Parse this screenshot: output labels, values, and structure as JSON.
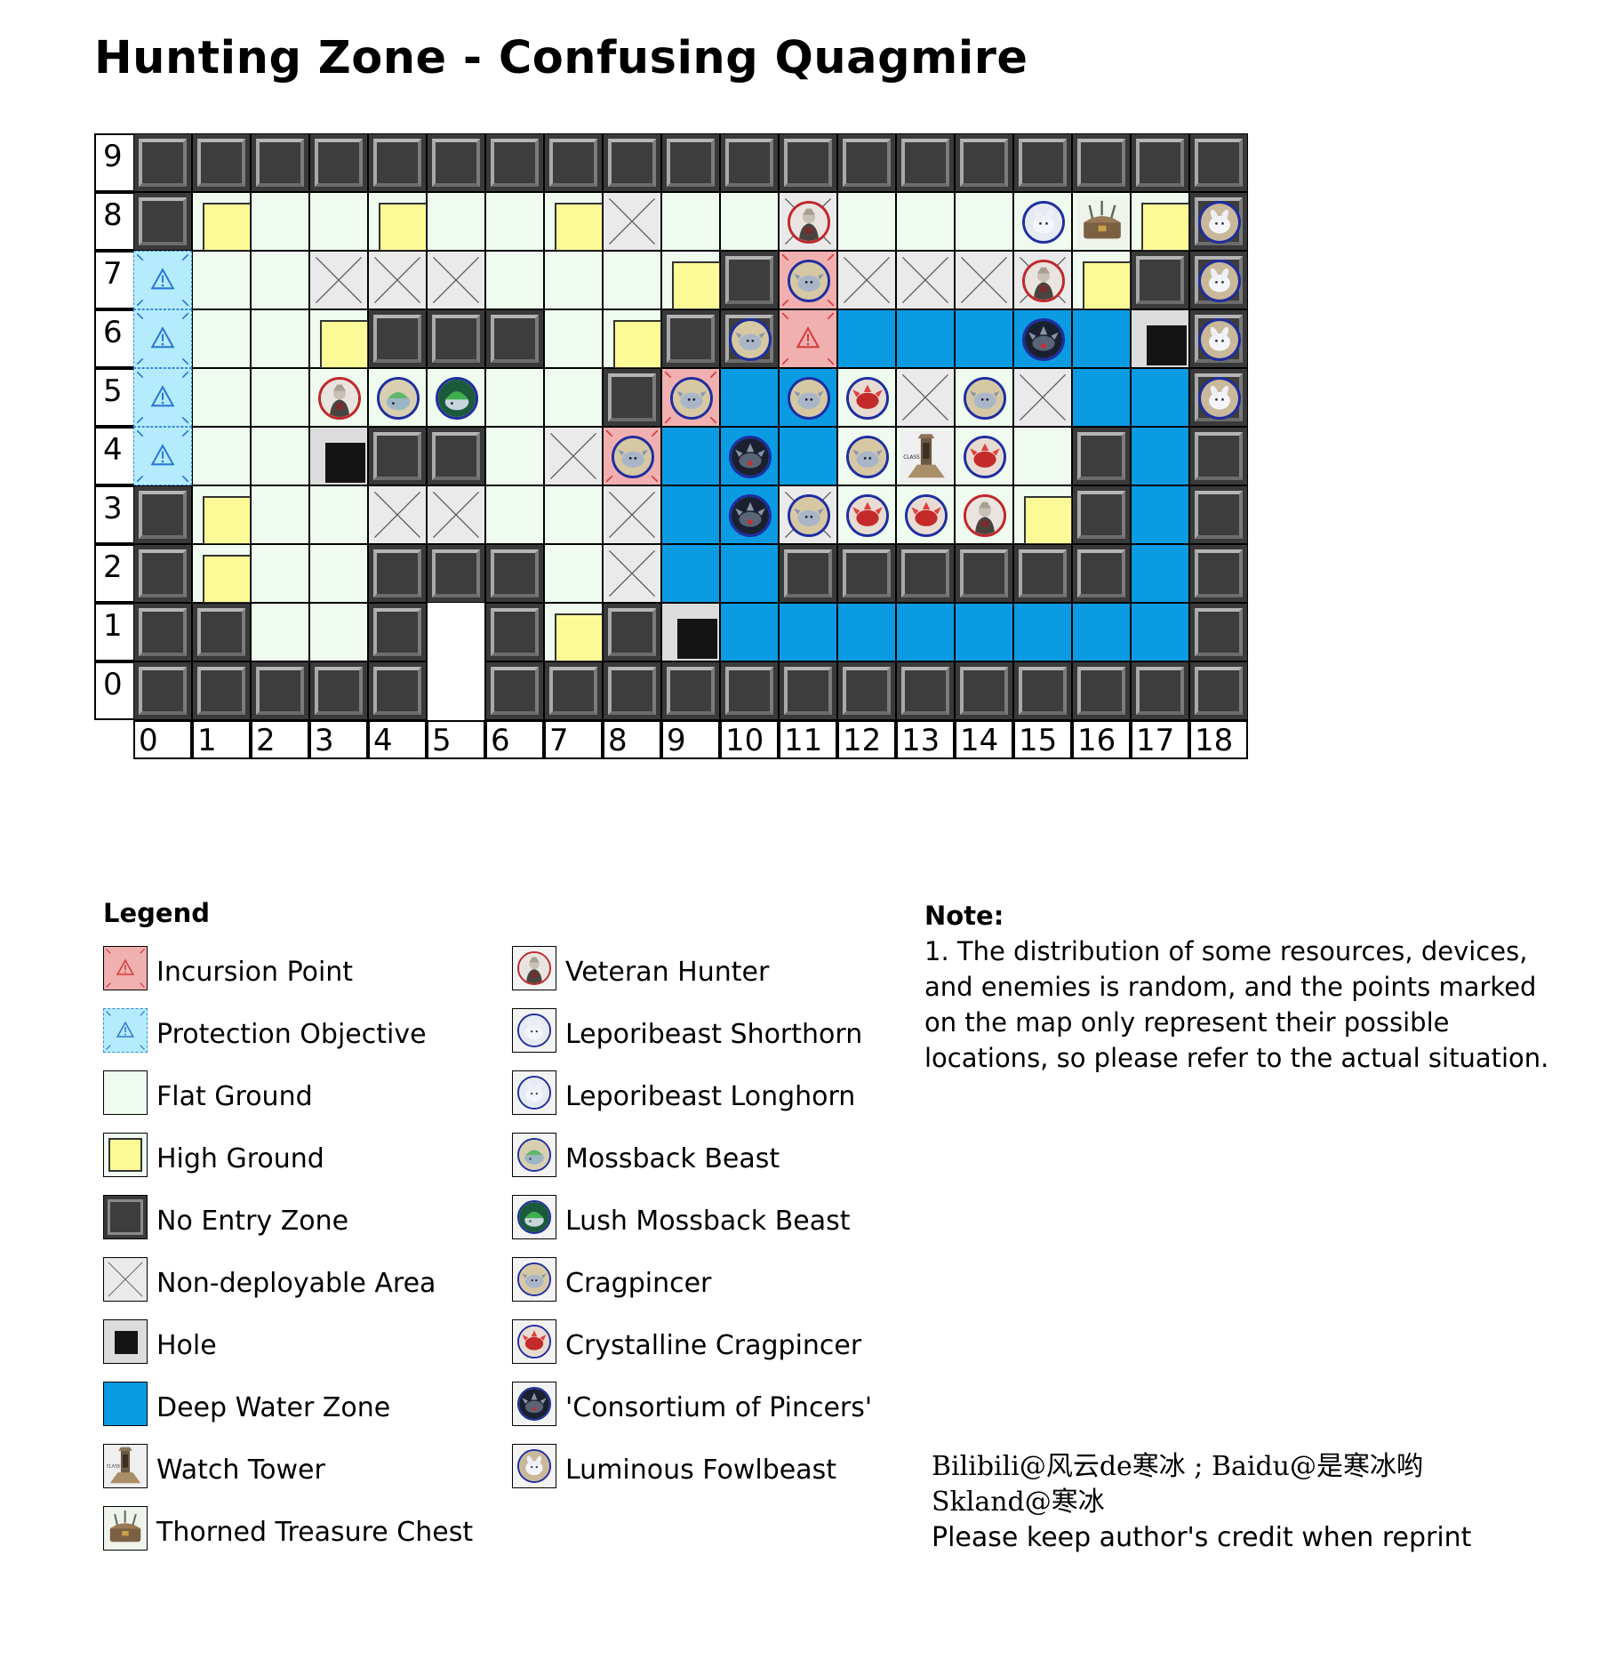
{
  "title": "Hunting Zone - Confusing Quagmire",
  "map": {
    "columns": 19,
    "rows": 10,
    "col_labels": [
      "0",
      "1",
      "2",
      "3",
      "4",
      "5",
      "6",
      "7",
      "8",
      "9",
      "10",
      "11",
      "12",
      "13",
      "14",
      "15",
      "16",
      "17",
      "18"
    ],
    "row_labels": [
      "9",
      "8",
      "7",
      "6",
      "5",
      "4",
      "3",
      "2",
      "1",
      "0"
    ],
    "terrain_rows_top_to_bottom": [
      "WWWWWWWWWWWWWWWWWWW",
      "WHFFHFFHXFFFFFFFFHW",
      "PFFXXXFFFHWIXXXXHWW",
      "PFFHWWWFHWIDDDDDDOW",
      "PFFFFFFFFWIDFFXFXDDW",
      "PFFOWWFXIDDDFFFFWDW",
      "WHFFXXFFXDDFFFFHWDW",
      "WHFFWWWFXDDWWWWWWDW",
      "WWFFWEWHWODDDDDDDDW",
      "WWWWWEWWWWWWWWWWWWW"
    ],
    "colors": {
      "flat": "#eefbee",
      "high_ground": "#fcfa96",
      "no_entry": "#3a3a3a",
      "deep_water": "#0a9be3",
      "protection": "#b5ecfd",
      "incursion": "#f1b0b0"
    },
    "markers": [
      {
        "row": 1,
        "col": 11,
        "unit": "veteran-hunter"
      },
      {
        "row": 1,
        "col": 15,
        "unit": "leporibeast-longhorn"
      },
      {
        "row": 1,
        "col": 16,
        "unit": "thorned-treasure-chest"
      },
      {
        "row": 1,
        "col": 18,
        "unit": "luminous-fowlbeast"
      },
      {
        "row": 2,
        "col": 11,
        "unit": "cragpincer"
      },
      {
        "row": 2,
        "col": 15,
        "unit": "veteran-hunter"
      },
      {
        "row": 2,
        "col": 18,
        "unit": "luminous-fowlbeast"
      },
      {
        "row": 3,
        "col": 10,
        "unit": "cragpincer"
      },
      {
        "row": 3,
        "col": 15,
        "unit": "consortium-of-pincers"
      },
      {
        "row": 3,
        "col": 18,
        "unit": "luminous-fowlbeast"
      },
      {
        "row": 4,
        "col": 3,
        "unit": "veteran-hunter"
      },
      {
        "row": 4,
        "col": 4,
        "unit": "mossback-beast"
      },
      {
        "row": 4,
        "col": 5,
        "unit": "lush-mossback-beast"
      },
      {
        "row": 4,
        "col": 9,
        "unit": "cragpincer"
      },
      {
        "row": 4,
        "col": 11,
        "unit": "cragpincer"
      },
      {
        "row": 4,
        "col": 12,
        "unit": "crystalline-cragpincer"
      },
      {
        "row": 4,
        "col": 14,
        "unit": "cragpincer"
      },
      {
        "row": 4,
        "col": 18,
        "unit": "luminous-fowlbeast"
      },
      {
        "row": 5,
        "col": 8,
        "unit": "cragpincer"
      },
      {
        "row": 5,
        "col": 10,
        "unit": "consortium-of-pincers"
      },
      {
        "row": 5,
        "col": 12,
        "unit": "cragpincer"
      },
      {
        "row": 5,
        "col": 13,
        "unit": "watch-tower"
      },
      {
        "row": 5,
        "col": 14,
        "unit": "crystalline-cragpincer"
      },
      {
        "row": 6,
        "col": 10,
        "unit": "consortium-of-pincers"
      },
      {
        "row": 6,
        "col": 11,
        "unit": "cragpincer"
      },
      {
        "row": 6,
        "col": 12,
        "unit": "crystalline-cragpincer"
      },
      {
        "row": 6,
        "col": 13,
        "unit": "crystalline-cragpincer"
      },
      {
        "row": 6,
        "col": 14,
        "unit": "veteran-hunter"
      }
    ]
  },
  "legend": {
    "title": "Legend",
    "left": [
      {
        "key": "incursion",
        "label": "Incursion Point"
      },
      {
        "key": "protect",
        "label": "Protection Objective"
      },
      {
        "key": "flat",
        "label": "Flat Ground"
      },
      {
        "key": "high",
        "label": "High Ground"
      },
      {
        "key": "wall",
        "label": "No Entry Zone"
      },
      {
        "key": "nodeploy",
        "label": "Non-deployable Area"
      },
      {
        "key": "hole",
        "label": "Hole"
      },
      {
        "key": "water",
        "label": "Deep Water Zone"
      },
      {
        "key": "watch-tower",
        "label": "Watch Tower"
      },
      {
        "key": "thorned-treasure-chest",
        "label": "Thorned Treasure Chest"
      }
    ],
    "right": [
      {
        "key": "veteran-hunter",
        "label": "Veteran Hunter"
      },
      {
        "key": "leporibeast-shorthorn",
        "label": "Leporibeast Shorthorn"
      },
      {
        "key": "leporibeast-longhorn",
        "label": "Leporibeast Longhorn"
      },
      {
        "key": "mossback-beast",
        "label": "Mossback Beast"
      },
      {
        "key": "lush-mossback-beast",
        "label": "Lush Mossback Beast"
      },
      {
        "key": "cragpincer",
        "label": "Cragpincer"
      },
      {
        "key": "crystalline-cragpincer",
        "label": "Crystalline Cragpincer"
      },
      {
        "key": "consortium-of-pincers",
        "label": "'Consortium of Pincers'"
      },
      {
        "key": "luminous-fowlbeast",
        "label": "Luminous Fowlbeast"
      }
    ]
  },
  "note": {
    "title": "Note:",
    "text": "1. The distribution of some resources, devices, and enemies is random, and the points marked on the map only represent their possible locations, so please refer to the actual situation."
  },
  "credit": {
    "line1": "Bilibili@风云de寒冰 ; Baidu@是寒冰哟",
    "line2": "Skland@寒冰",
    "line3": "Please keep author's credit when reprint"
  }
}
